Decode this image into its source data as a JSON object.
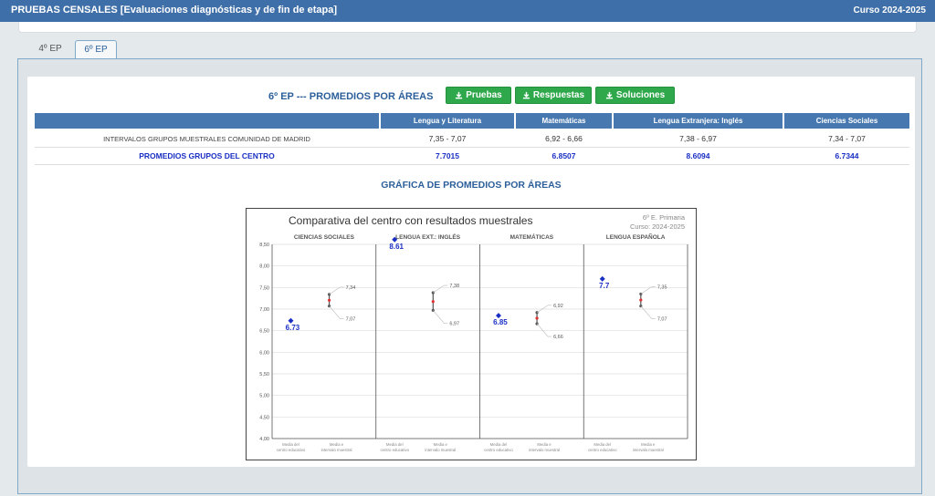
{
  "header": {
    "title": "PRUEBAS CENSALES [Evaluaciones diagnósticas y de fin de etapa]",
    "course": "Curso 2024-2025"
  },
  "tabs": [
    {
      "label": "4º EP",
      "active": false
    },
    {
      "label": "6º EP",
      "active": true
    }
  ],
  "section": {
    "title": "6º EP --- PROMEDIOS POR ÁREAS",
    "buttons": {
      "pruebas": "Pruebas",
      "respuestas": "Respuestas",
      "soluciones": "Soluciones"
    }
  },
  "table": {
    "headers": [
      "",
      "Lengua y Literatura",
      "Matemáticas",
      "Lengua Extranjera: Inglés",
      "Ciencias Sociales"
    ],
    "rows": [
      [
        "INTERVALOS GRUPOS MUESTRALES COMUNIDAD DE MADRID",
        "7,35 - 7,07",
        "6,92 - 6,66",
        "7,38 - 6,97",
        "7,34 - 7,07"
      ],
      [
        "PROMEDIOS GRUPOS DEL CENTRO",
        "7.7015",
        "6.8507",
        "8.6094",
        "6.7344"
      ]
    ]
  },
  "chart_section_title": "GRÁFICA DE PROMEDIOS POR ÁREAS",
  "chart_data": {
    "type": "scatter",
    "title": "Comparativa del centro con resultados muestrales",
    "subtitle": [
      "6º E. Primaria",
      "Curso: 2024-2025"
    ],
    "ylim": [
      4.0,
      8.5
    ],
    "yticks": [
      "4,00",
      "4,50",
      "5,00",
      "5,50",
      "6,00",
      "6,50",
      "7,00",
      "7,50",
      "8,00",
      "8,50"
    ],
    "x_labels": [
      "Media del centro educativo",
      "Media e intervalo muestral"
    ],
    "grid": true,
    "panels": [
      {
        "name": "CIENCIAS SOCIALES",
        "center": 6.73,
        "center_label": "6.73",
        "high": 7.34,
        "low": 7.07,
        "high_label": "7,34",
        "low_label": "7,07"
      },
      {
        "name": "LENGUA EXT.: INGLÉS",
        "center": 8.61,
        "center_label": "8.61",
        "high": 7.38,
        "low": 6.97,
        "high_label": "7,38",
        "low_label": "6,97"
      },
      {
        "name": "MATEMÁTICAS",
        "center": 6.85,
        "center_label": "6.85",
        "high": 6.92,
        "low": 6.66,
        "high_label": "6,92",
        "low_label": "6,66"
      },
      {
        "name": "LENGUA ESPAÑOLA",
        "center": 7.7,
        "center_label": "7.7",
        "high": 7.35,
        "low": 7.07,
        "high_label": "7,35",
        "low_label": "7,07"
      }
    ],
    "colors": {
      "center": "#1a2fc4",
      "mean": "#e03030",
      "interval": "#555555"
    }
  }
}
